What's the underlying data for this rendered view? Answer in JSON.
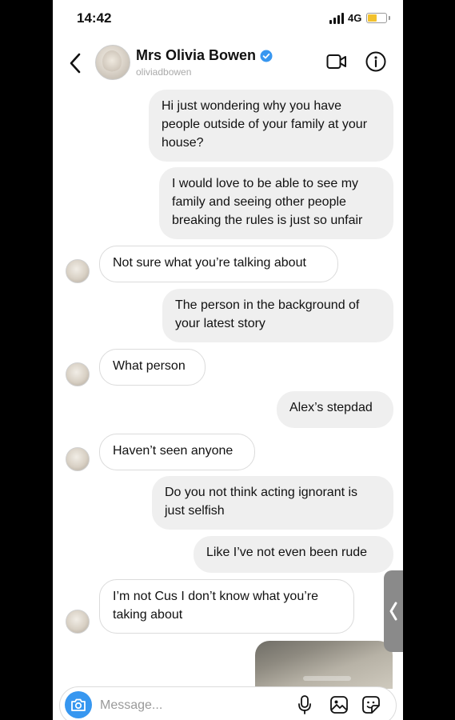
{
  "status": {
    "time": "14:42",
    "network": "4G"
  },
  "header": {
    "name": "Mrs Olivia Bowen",
    "handle": "oliviadbowen",
    "verified_color": "#3897f0"
  },
  "messages": [
    {
      "direction": "out",
      "text": "Hi just wondering why you have\npeople outside of your family at your\nhouse?"
    },
    {
      "direction": "out",
      "text": "I would love to be able to see my\nfamily and seeing other people\nbreaking the rules is just so unfair"
    },
    {
      "direction": "in",
      "text": "Not sure what you’re talking about"
    },
    {
      "direction": "out",
      "text": "The person in the background of\nyour latest story"
    },
    {
      "direction": "in",
      "text": "What person"
    },
    {
      "direction": "out",
      "text": "Alex’s stepdad"
    },
    {
      "direction": "in",
      "text": "Haven’t seen anyone"
    },
    {
      "direction": "out",
      "text": "Do you not think acting ignorant is\njust selfish"
    },
    {
      "direction": "out",
      "text": "Like I’ve not even been rude"
    },
    {
      "direction": "in",
      "text": "I’m not Cus I don’t know what you’re\ntaking about"
    }
  ],
  "composer": {
    "placeholder": "Message...",
    "accent": "#3797f0"
  },
  "icons": [
    "back-chevron-icon",
    "verified-badge-icon",
    "video-call-icon",
    "info-icon",
    "camera-icon",
    "microphone-icon",
    "gallery-icon",
    "sticker-icon",
    "chevron-left-icon"
  ]
}
